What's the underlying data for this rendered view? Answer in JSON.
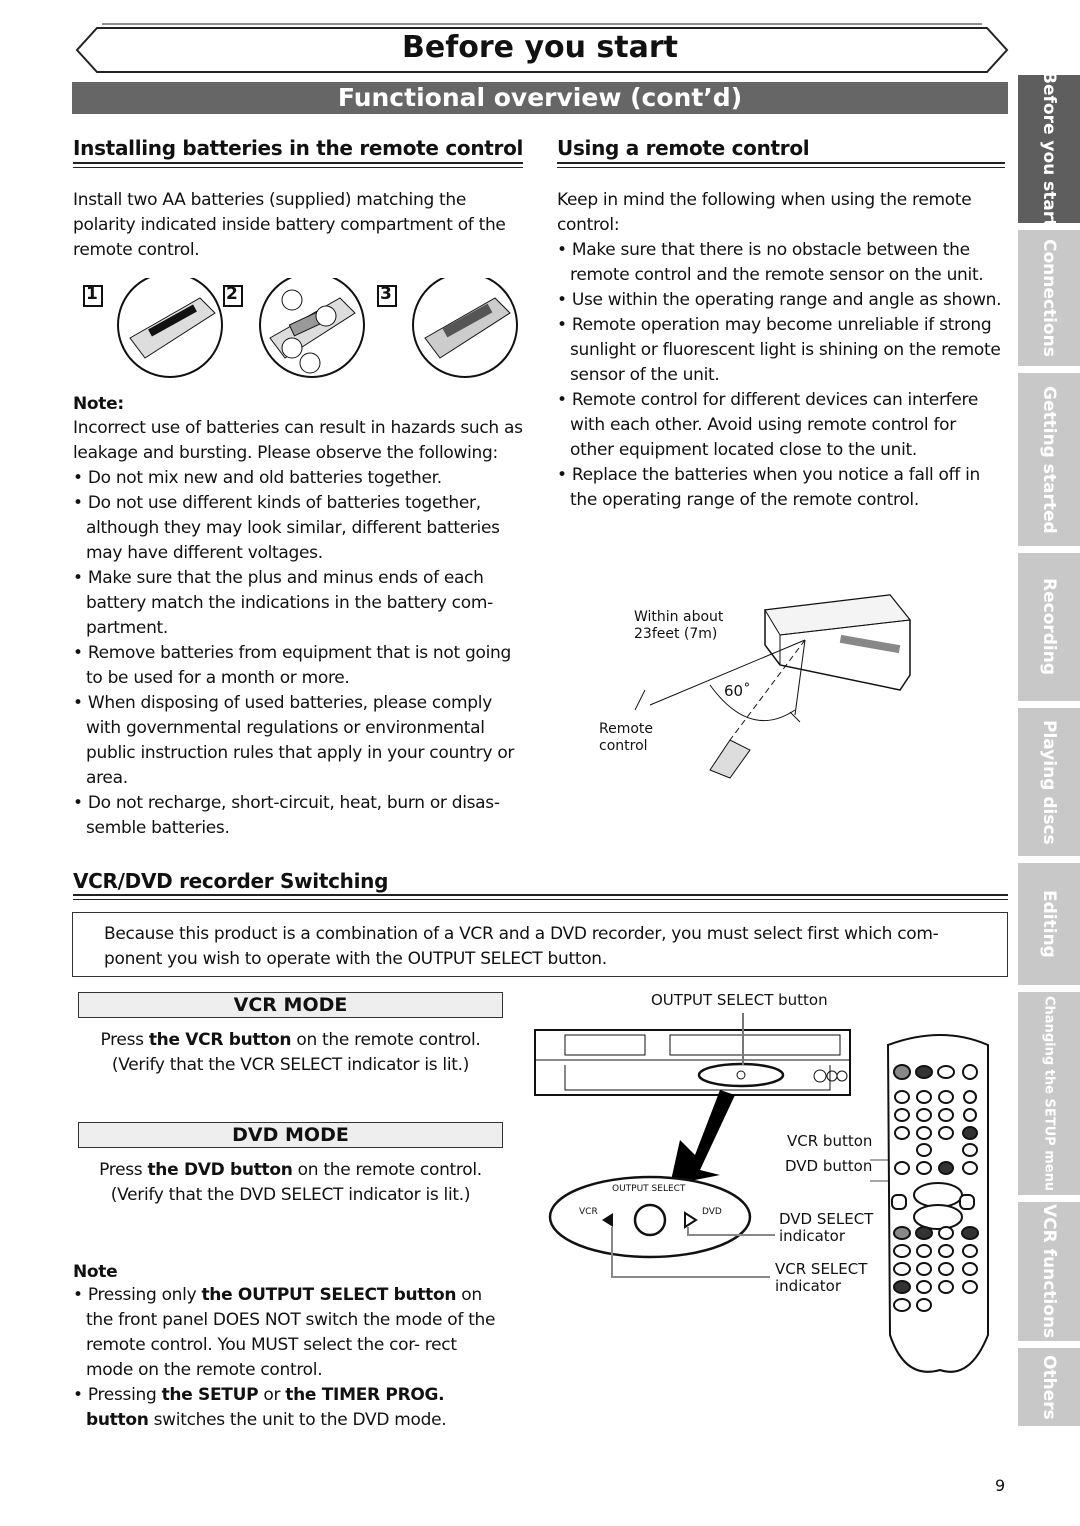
{
  "header": {
    "title": "Before you start",
    "subtitle": "Functional overview (cont’d)"
  },
  "side_tabs": [
    {
      "label": "Before you start",
      "active": true
    },
    {
      "label": "Connections"
    },
    {
      "label": "Getting started"
    },
    {
      "label": "Recording"
    },
    {
      "label": "Playing discs"
    },
    {
      "label": "Editing"
    },
    {
      "label": "Changing the SETUP menu"
    },
    {
      "label": "VCR functions"
    },
    {
      "label": "Others"
    }
  ],
  "batteries": {
    "heading": "Installing batteries in the remote control",
    "intro": "Install two AA batteries (supplied) matching the polarity indicated inside battery compartment of the remote control.",
    "steps": [
      "1",
      "2",
      "3"
    ],
    "note_label": "Note:",
    "note_intro": "Incorrect use of batteries can result in hazards such as leakage and bursting. Please observe the following:",
    "bullets": [
      "• Do not mix new and old batteries together.",
      "• Do not use different kinds of batteries together, although they may look similar, different batteries may have different voltages.",
      "• Make sure that the plus and minus ends of each battery match the indications in the battery com- partment.",
      "• Remove batteries from equipment that is not going to be used for a month or more.",
      "• When disposing of used batteries, please comply with governmental regulations or environmental public instruction rules that apply in your country or area.",
      "• Do not recharge, short-circuit, heat, burn or disas- semble batteries."
    ]
  },
  "remote": {
    "heading": "Using a remote control",
    "intro": "Keep in mind the following when using the remote control:",
    "bullets": [
      "• Make sure that there is no obstacle between the remote control and the remote sensor on the unit.",
      "• Use within the operating range and angle as shown.",
      "• Remote operation may become unreliable if strong sunlight or fluorescent light is shining on the remote sensor of the unit.",
      "• Remote control for different devices can interfere with each other. Avoid using remote control for other equipment located close to the unit.",
      "• Replace the batteries when you notice a fall off in the operating range of the remote control."
    ],
    "diagram": {
      "range_line1": "Within about",
      "range_line2": "23feet (7m)",
      "angle": "60˚",
      "remote_line1": "Remote",
      "remote_line2": "control"
    }
  },
  "switching": {
    "heading": "VCR/DVD recorder Switching",
    "intro": "Because this product is a combination of a VCR and a DVD recorder, you must select first which com- ponent you wish to operate with the OUTPUT SELECT button.",
    "vcr_mode": {
      "title": "VCR MODE",
      "l1a": "Press ",
      "l1b": "the VCR button",
      "l1c": " on the remote control.",
      "l2": "(Verify that the VCR SELECT indicator is lit.)"
    },
    "dvd_mode": {
      "title": "DVD MODE",
      "l1a": "Press ",
      "l1b": "the DVD button",
      "l1c": " on the remote control.",
      "l2": "(Verify that the DVD SELECT indicator is lit.)"
    },
    "note_label": "Note",
    "note1a": "• Pressing only ",
    "note1b": "the OUTPUT SELECT button",
    "note1c": " on the front panel DOES NOT switch the mode of the remote control. You MUST select the cor- rect mode on the remote control.",
    "note2a": "• Pressing ",
    "note2b": "the SETUP",
    "note2c": " or ",
    "note2d": "the TIMER PROG.",
    "note2e": " button",
    "note2f": " switches the unit to the DVD mode.",
    "diagram": {
      "output_select_button": "OUTPUT SELECT button",
      "output_select": "OUTPUT SELECT",
      "vcr": "VCR",
      "dvd": "DVD",
      "vcr_button": "VCR button",
      "dvd_button": "DVD button",
      "dvd_select_1": "DVD SELECT",
      "dvd_select_2": "indicator",
      "vcr_select_1": "VCR SELECT",
      "vcr_select_2": "indicator"
    }
  },
  "page_number": "9"
}
